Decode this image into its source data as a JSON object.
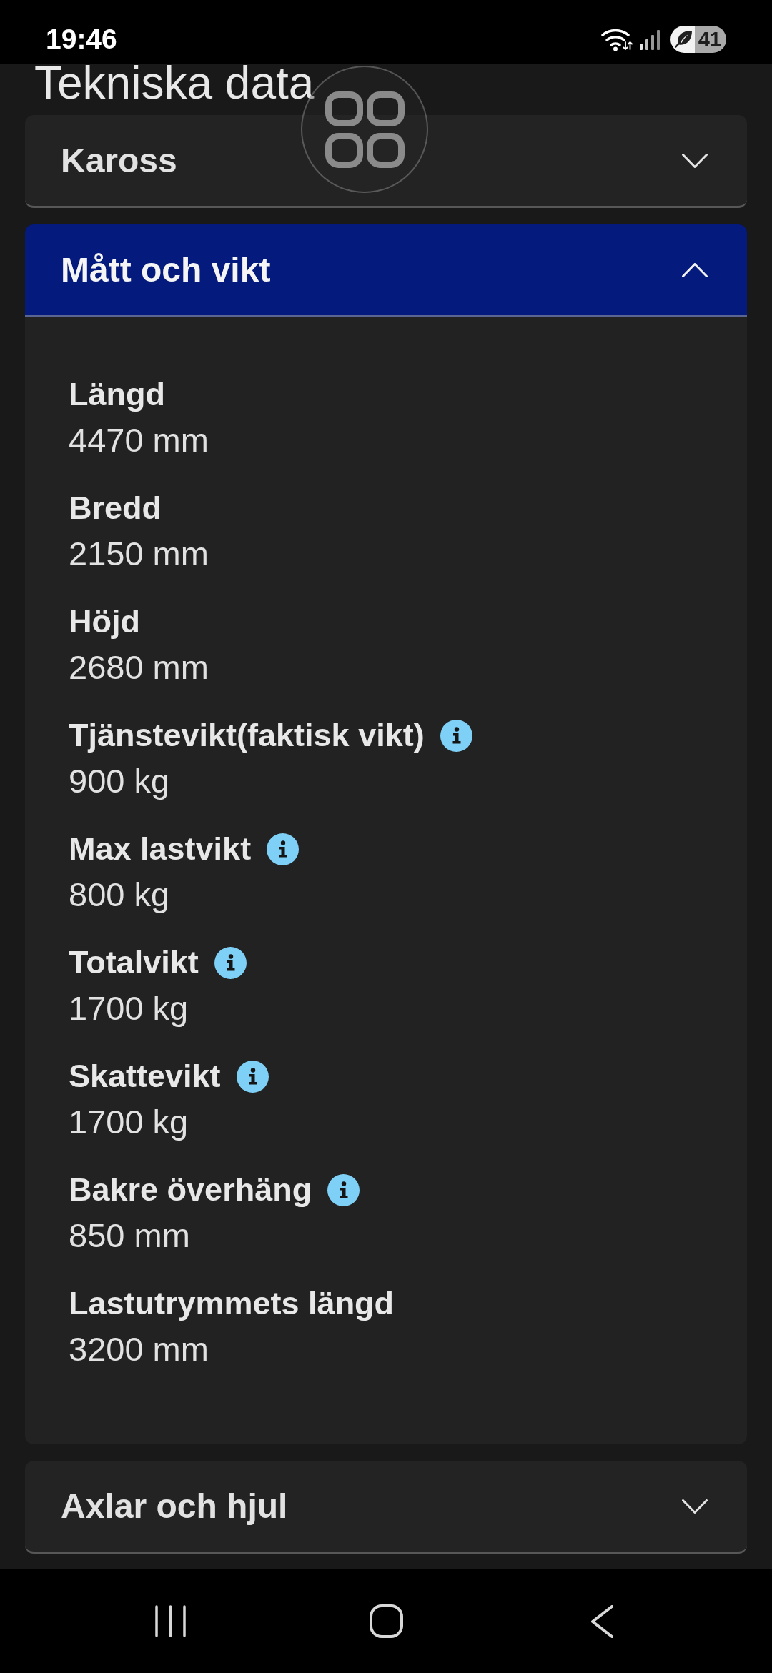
{
  "status_bar": {
    "time": "19:46",
    "battery": "41"
  },
  "page_title": "Tekniska data",
  "sections": [
    {
      "title": "Kaross",
      "expanded": false
    },
    {
      "title": "Mått och vikt",
      "expanded": true,
      "items": [
        {
          "label": "Längd",
          "value": "4470 mm",
          "info": false
        },
        {
          "label": "Bredd",
          "value": "2150 mm",
          "info": false
        },
        {
          "label": "Höjd",
          "value": "2680 mm",
          "info": false
        },
        {
          "label": "Tjänstevikt(faktisk vikt)",
          "value": "900 kg",
          "info": true
        },
        {
          "label": "Max lastvikt",
          "value": "800 kg",
          "info": true
        },
        {
          "label": "Totalvikt",
          "value": "1700 kg",
          "info": true
        },
        {
          "label": "Skattevikt",
          "value": "1700 kg",
          "info": true
        },
        {
          "label": "Bakre överhäng",
          "value": "850 mm",
          "info": true
        },
        {
          "label": "Lastutrymmets längd",
          "value": "3200 mm",
          "info": false
        }
      ]
    },
    {
      "title": "Axlar och hjul",
      "expanded": false
    }
  ]
}
